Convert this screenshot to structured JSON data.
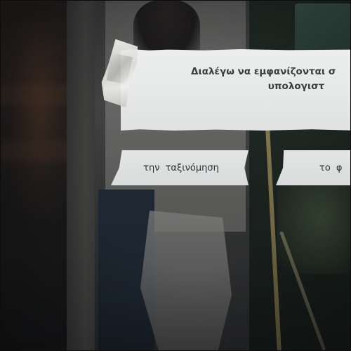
{
  "prompt": {
    "line1": "Διαλέγω να εμφανίζονται σ",
    "line2": "υπολογιστ"
  },
  "options": [
    {
      "label": "την  ταξινόμηση"
    },
    {
      "label": "το  φ"
    }
  ],
  "colors": {
    "paper": "#e6e8e8",
    "text": "#3a3c3e",
    "background": "#1b1d1e"
  },
  "icons": {
    "tape": "tape-strip-icon"
  }
}
